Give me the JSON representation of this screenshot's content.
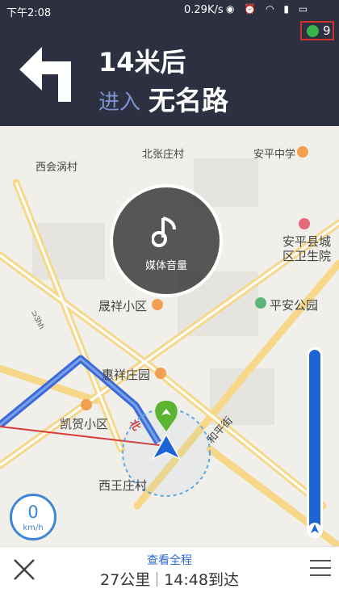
{
  "status_bar": {
    "time": "下午2:08",
    "network_speed": "0.29K/s",
    "icons": [
      "network-icon",
      "alarm-icon",
      "wifi-icon",
      "signal-icon",
      "battery-icon"
    ]
  },
  "nav": {
    "distance": "14米后",
    "action": "进入",
    "road_name": "无名路",
    "turn_direction": "left",
    "gps_satellites": "9"
  },
  "map": {
    "labels": [
      {
        "text": "北张庄村"
      },
      {
        "text": "安平中学"
      },
      {
        "text": "西会涡村"
      },
      {
        "text": "安平县城"
      },
      {
        "text": "区卫生院"
      },
      {
        "text": "晟祥小区"
      },
      {
        "text": "平安公园"
      },
      {
        "text": "惠祥庄园"
      },
      {
        "text": "凯贺小区"
      },
      {
        "text": "西王庄村"
      },
      {
        "text": "和平街"
      },
      {
        "text": "北"
      }
    ],
    "media_label": "媒体音量"
  },
  "speed": {
    "value": "0",
    "unit": "km/h"
  },
  "route_progress": 1.0,
  "bottom": {
    "overview_label": "查看全程",
    "distance_remaining": "27公里",
    "eta": "14:48到达"
  },
  "colors": {
    "header_bg": "#2c3040",
    "accent_blue": "#1c64d6",
    "route_blue": "#3a6bd8",
    "gps_green": "#36b34a"
  }
}
